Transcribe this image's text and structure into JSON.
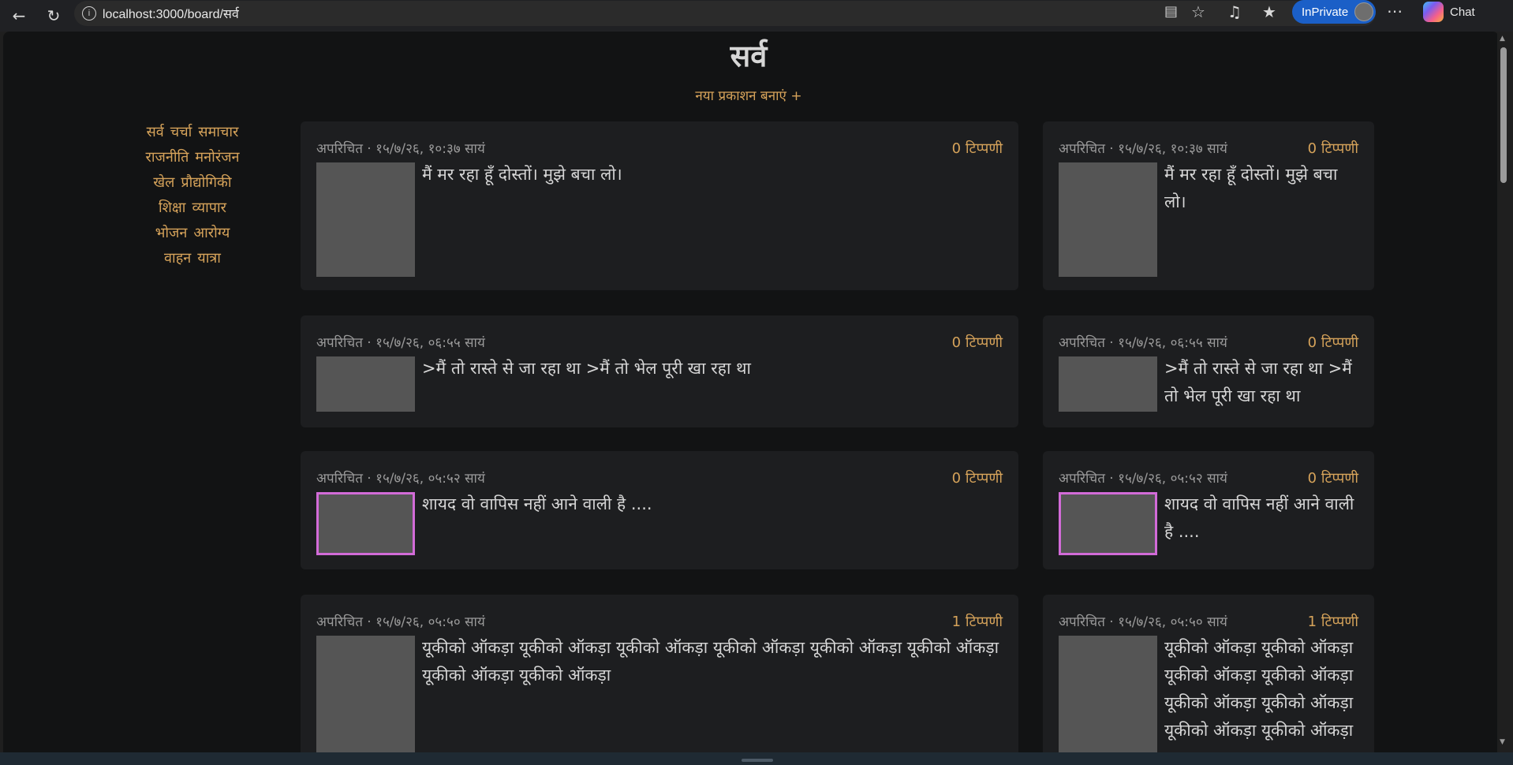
{
  "browser": {
    "url": "localhost:3000/board/सर्व",
    "inprivate_label": "InPrivate",
    "chat_label": "Chat"
  },
  "page": {
    "title": "सर्व",
    "new_post_label": "नया प्रकाशन बनाएं +"
  },
  "sidebar": {
    "rows": [
      [
        "सर्व",
        "चर्चा",
        "समाचार"
      ],
      [
        "राजनीति",
        "मनोरंजन"
      ],
      [
        "खेल",
        "प्रौद्योगिकी"
      ],
      [
        "शिक्षा",
        "व्यापार"
      ],
      [
        "भोजन",
        "आरोग्य"
      ],
      [
        "वाहन",
        "यात्रा"
      ]
    ]
  },
  "posts": [
    {
      "author": "अपरिचित",
      "time": "१५/७/२६, १०:३७ सायं",
      "comments": "0 टिप्पणी",
      "text": "मैं मर रहा हूँ दोस्तों। मुझे बचा लो।"
    },
    {
      "author": "अपरिचित",
      "time": "१५/७/२६, ०६:५५ सायं",
      "comments": "0 टिप्पणी",
      "text": ">मैं तो रास्ते से जा रहा था >मैं तो भेल पूरी खा रहा था"
    },
    {
      "author": "अपरिचित",
      "time": "१५/७/२६, ०५:५२ सायं",
      "comments": "0 टिप्पणी",
      "text": "शायद वो वापिस नहीं आने वाली है ...."
    },
    {
      "author": "अपरिचित",
      "time": "१५/७/२६, ०५:५० सायं",
      "comments": "1 टिप्पणी",
      "text": "यूकीको ऑकड़ा यूकीको ऑकड़ा यूकीको ऑकड़ा यूकीको ऑकड़ा यूकीको ऑकड़ा यूकीको ऑकड़ा यूकीको ऑकड़ा यूकीको ऑकड़ा"
    }
  ]
}
